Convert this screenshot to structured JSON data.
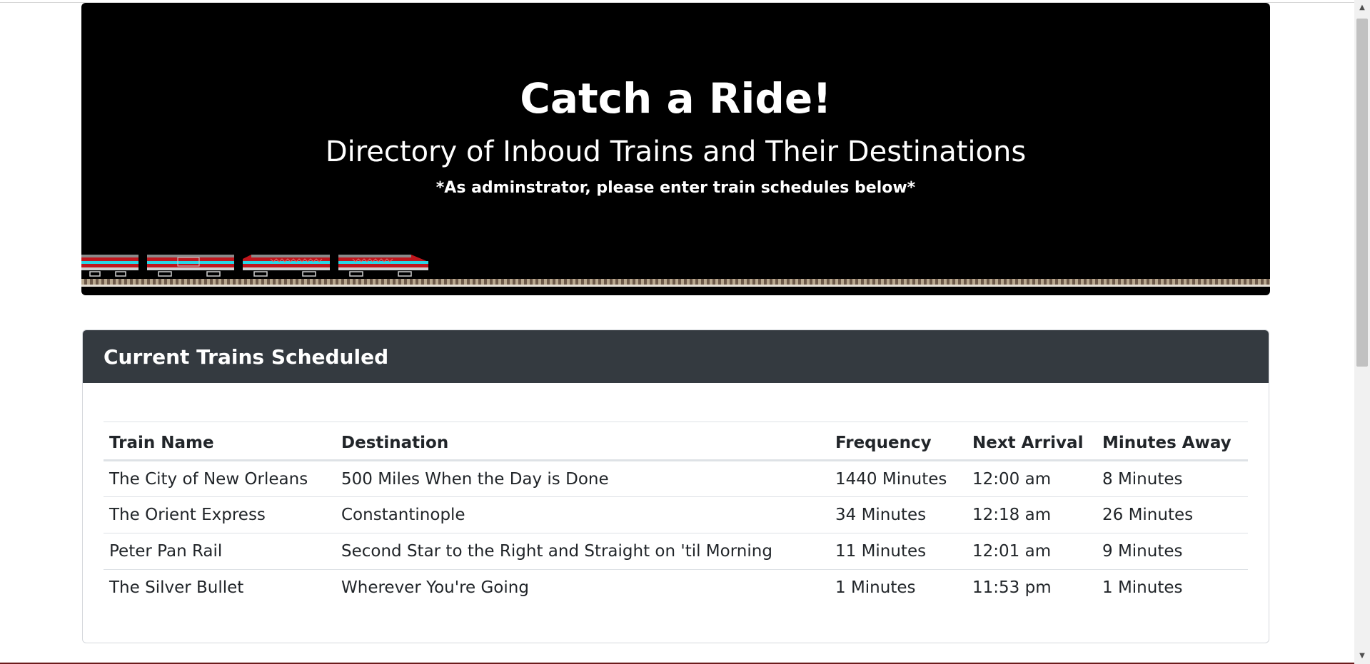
{
  "header": {
    "title": "Catch a Ride!",
    "subtitle": "Directory of Inboud Trains and Their Destinations",
    "note": "*As adminstrator, please enter train schedules below*"
  },
  "schedule": {
    "title": "Current Trains Scheduled",
    "columns": [
      "Train Name",
      "Destination",
      "Frequency",
      "Next Arrival",
      "Minutes Away"
    ],
    "rows": [
      [
        "The City of New Orleans",
        "500 Miles When the Day is Done",
        "1440 Minutes",
        "12:00 am",
        "8 Minutes"
      ],
      [
        "The Orient Express",
        "Constantinople",
        "34 Minutes",
        "12:18 am",
        "26 Minutes"
      ],
      [
        "Peter Pan Rail",
        "Second Star to the Right and Straight on 'til Morning",
        "11 Minutes",
        "12:01 am",
        "9 Minutes"
      ],
      [
        "The Silver Bullet",
        "Wherever You're Going",
        "1 Minutes",
        "11:53 pm",
        "1 Minutes"
      ]
    ]
  },
  "colors": {
    "banner_bg": "#000000",
    "card_header_bg": "#343a40",
    "train_red": "#c0161c",
    "train_stripe": "#29d6e6"
  },
  "icons": [
    "train-illustration",
    "chevron-up-icon",
    "chevron-down-icon"
  ]
}
